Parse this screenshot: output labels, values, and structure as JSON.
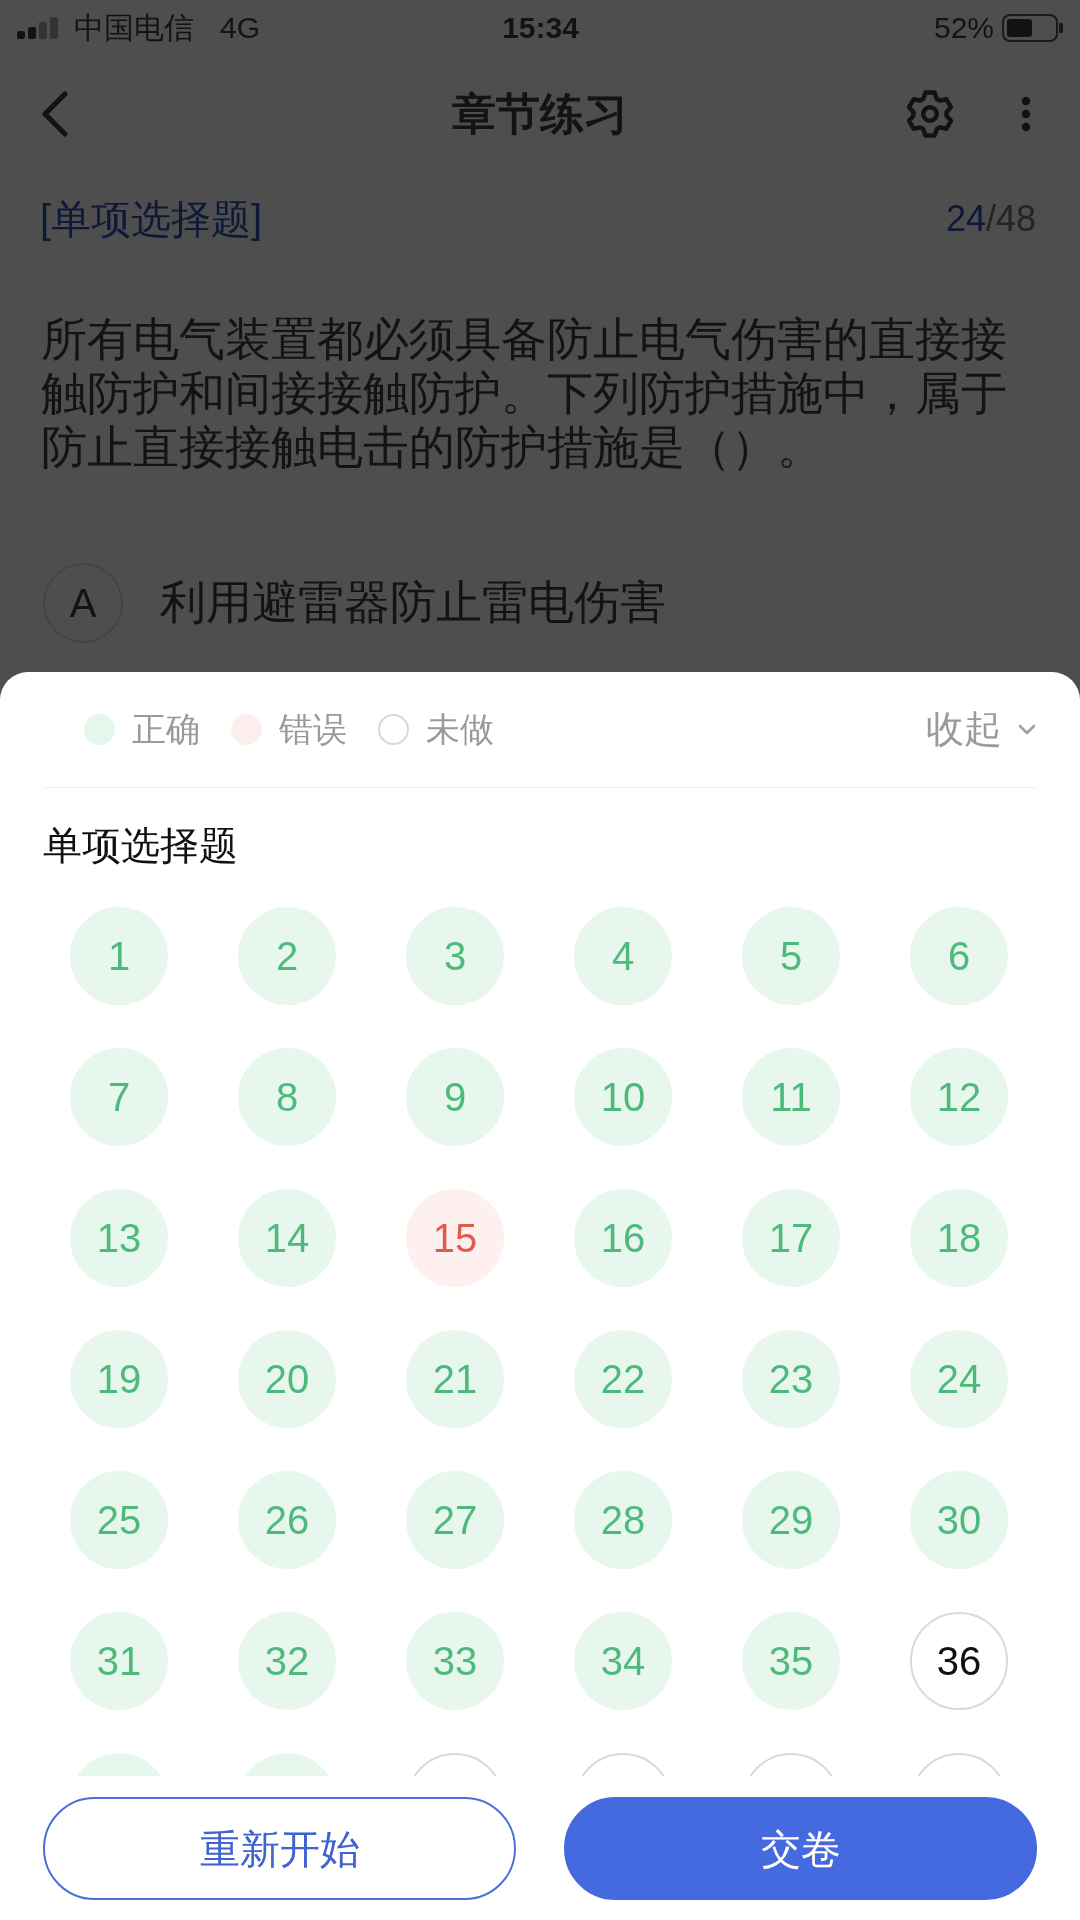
{
  "status_bar": {
    "carrier": "中国电信",
    "network": "4G",
    "time": "15:34",
    "battery": "52%"
  },
  "nav_bar": {
    "title": "章节练习"
  },
  "question": {
    "type_label": "[单项选择题]",
    "counter": {
      "current": "24",
      "total": "/48"
    },
    "text": "所有电气装置都必须具备防止电气伤害的直接接触防护和间接接触防护。下列防护措施中，属于防止直接接触电击的防护措施是（）。",
    "options": [
      {
        "letter": "A",
        "text": "利用避雷器防止雷电伤害"
      }
    ]
  },
  "answer_sheet": {
    "legend": [
      {
        "kind": "correct",
        "label": "正确"
      },
      {
        "kind": "wrong",
        "label": "错误"
      },
      {
        "kind": "unanswered",
        "label": "未做"
      }
    ],
    "collapse_label": "收起",
    "section_title": "单项选择题",
    "items": [
      {
        "number": "1",
        "kind": "correct"
      },
      {
        "number": "2",
        "kind": "correct"
      },
      {
        "number": "3",
        "kind": "correct"
      },
      {
        "number": "4",
        "kind": "correct"
      },
      {
        "number": "5",
        "kind": "correct"
      },
      {
        "number": "6",
        "kind": "correct"
      },
      {
        "number": "7",
        "kind": "correct"
      },
      {
        "number": "8",
        "kind": "correct"
      },
      {
        "number": "9",
        "kind": "correct"
      },
      {
        "number": "10",
        "kind": "correct"
      },
      {
        "number": "11",
        "kind": "correct"
      },
      {
        "number": "12",
        "kind": "correct"
      },
      {
        "number": "13",
        "kind": "correct"
      },
      {
        "number": "14",
        "kind": "correct"
      },
      {
        "number": "15",
        "kind": "wrong"
      },
      {
        "number": "16",
        "kind": "correct"
      },
      {
        "number": "17",
        "kind": "correct"
      },
      {
        "number": "18",
        "kind": "correct"
      },
      {
        "number": "19",
        "kind": "correct"
      },
      {
        "number": "20",
        "kind": "correct"
      },
      {
        "number": "21",
        "kind": "correct"
      },
      {
        "number": "22",
        "kind": "correct"
      },
      {
        "number": "23",
        "kind": "correct"
      },
      {
        "number": "24",
        "kind": "correct"
      },
      {
        "number": "25",
        "kind": "correct"
      },
      {
        "number": "26",
        "kind": "correct"
      },
      {
        "number": "27",
        "kind": "correct"
      },
      {
        "number": "28",
        "kind": "correct"
      },
      {
        "number": "29",
        "kind": "correct"
      },
      {
        "number": "30",
        "kind": "correct"
      },
      {
        "number": "31",
        "kind": "correct"
      },
      {
        "number": "32",
        "kind": "correct"
      },
      {
        "number": "33",
        "kind": "correct"
      },
      {
        "number": "34",
        "kind": "correct"
      },
      {
        "number": "35",
        "kind": "correct"
      },
      {
        "number": "36",
        "kind": "unanswered"
      },
      {
        "kind": "correct"
      },
      {
        "kind": "correct"
      },
      {
        "kind": "unanswered"
      },
      {
        "kind": "unanswered"
      },
      {
        "kind": "unanswered"
      },
      {
        "kind": "unanswered"
      }
    ]
  },
  "buttons": [
    {
      "kind": "outline",
      "label": "重新开始"
    },
    {
      "kind": "primary",
      "label": "交卷"
    }
  ]
}
